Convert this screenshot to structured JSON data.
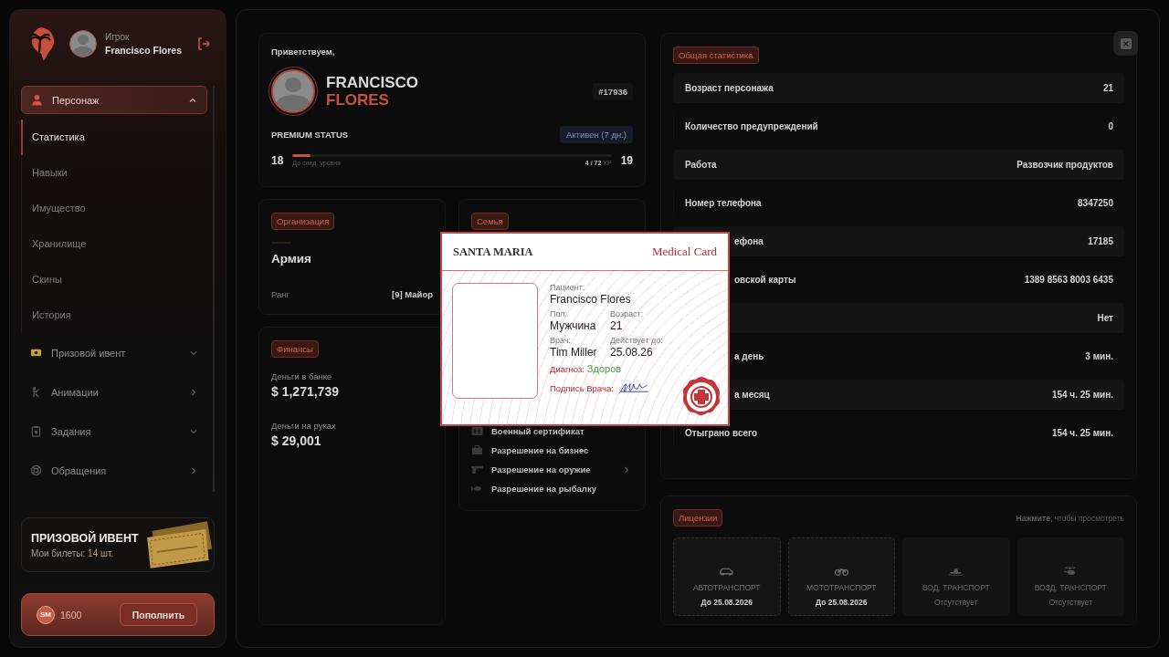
{
  "sidebar": {
    "user": {
      "role": "Игрок",
      "name": "Francisco Flores"
    },
    "menu": [
      {
        "label": "Персонаж",
        "kind": "group",
        "expanded": true,
        "children": [
          {
            "label": "Статистика",
            "selected": true
          },
          {
            "label": "Навыки",
            "selected": false
          },
          {
            "label": "Имущество",
            "selected": false
          },
          {
            "label": "Хранилище",
            "selected": false
          },
          {
            "label": "Скины",
            "selected": false
          },
          {
            "label": "История",
            "selected": false
          }
        ]
      },
      {
        "label": "Призовой ивент",
        "kind": "group",
        "expanded": false
      },
      {
        "label": "Анимации",
        "kind": "link"
      },
      {
        "label": "Задания",
        "kind": "group",
        "expanded": false
      },
      {
        "label": "Обращения",
        "kind": "link"
      }
    ],
    "promo": {
      "title": "ПРИЗОВОЙ ИВЕНТ",
      "tickets_label": "Мои билеты:",
      "tickets_value": "14 шт."
    },
    "balance": {
      "coin": "SM",
      "amount": "1600",
      "button": "Пополнить"
    }
  },
  "profile": {
    "greeting": "Приветствуем,",
    "first_name": "FRANCISCO",
    "last_name": "FLORES",
    "id": "#17936",
    "premium_label": "PREMIUM STATUS",
    "premium_badge": "Активен (7 дн.)",
    "level": "18",
    "next_level": "19",
    "progress": {
      "level": 0.055,
      "caption": "До след. уровня",
      "xp": "4 / 72",
      "unit": "XP"
    }
  },
  "organization": {
    "badge": "Организация",
    "name": "Армия",
    "rank_label": "Ранг",
    "rank": "[9] Майор"
  },
  "family": {
    "badge": "Семья",
    "documents": [
      {
        "label": "Военный сертификат",
        "arrow": false
      },
      {
        "label": "Разрешение на бизнес",
        "arrow": false
      },
      {
        "label": "Разрешение на оружие",
        "arrow": true
      },
      {
        "label": "Разрешение на рыбалку",
        "arrow": false
      }
    ]
  },
  "finances": {
    "badge": "Финансы",
    "items": [
      {
        "label": "Деньги в банке",
        "value": "$ 1,271,739"
      },
      {
        "label": "Деньги на руках",
        "value": "$ 29,001"
      }
    ]
  },
  "stats": {
    "badge": "Общая статистика",
    "rows": [
      {
        "label": "Возраст персонажа",
        "value": "21"
      },
      {
        "label": "Количество предупреждений",
        "value": "0"
      },
      {
        "label": "Работа",
        "value": "Развозчик продуктов"
      },
      {
        "label": "Номер телефона",
        "value": "8347250"
      },
      {
        "label": "ефона",
        "value": "17185",
        "kind": "partial"
      },
      {
        "label": "овской карты",
        "value": "1389 8563 8003 6435",
        "kind": "partial"
      },
      {
        "value": "Нет"
      },
      {
        "label": "а день",
        "value": "3 мин.",
        "kind": "partial"
      },
      {
        "label": "а месяц",
        "value": "154 ч. 25 мин.",
        "kind": "partial"
      },
      {
        "label": "Отыграно всего",
        "value": "154 ч. 25 мин."
      }
    ]
  },
  "licenses": {
    "badge": "Лицензии",
    "hint": "**Нажмите,** чтобы просмотреть",
    "items": [
      {
        "name": "АВТОТРАНСПОРТ",
        "status": "До 25.08.2026",
        "active": true
      },
      {
        "name": "МОТОТРАНСПОРТ",
        "status": "До 25.08.2026",
        "active": true
      },
      {
        "name": "ВОД. ТРАНСПОРТ",
        "status": "Отсутствует",
        "active": false
      },
      {
        "name": "ВОЗД. ТРАНСПОРТ",
        "status": "Отсутствует",
        "active": false
      }
    ]
  },
  "medical_card": {
    "brand": "SANTA MARIA",
    "title": "Medical Card",
    "fields": [
      {
        "label": "Пациент:",
        "value": "Francisco Flores",
        "kind": "wide"
      },
      {
        "label": "Пол:",
        "value": "Мужчина",
        "kind": "half"
      },
      {
        "label": "Возраст:",
        "value": "21",
        "kind": "half"
      },
      {
        "label": "Врач:",
        "value": "Tim Miller",
        "kind": "half"
      },
      {
        "label": "Действует до:",
        "value": "25.08.26",
        "kind": "half"
      }
    ],
    "diagnosis_label": "Диагноз:",
    "diagnosis": "Здоров",
    "signature_label": "Подпись Врача:"
  }
}
